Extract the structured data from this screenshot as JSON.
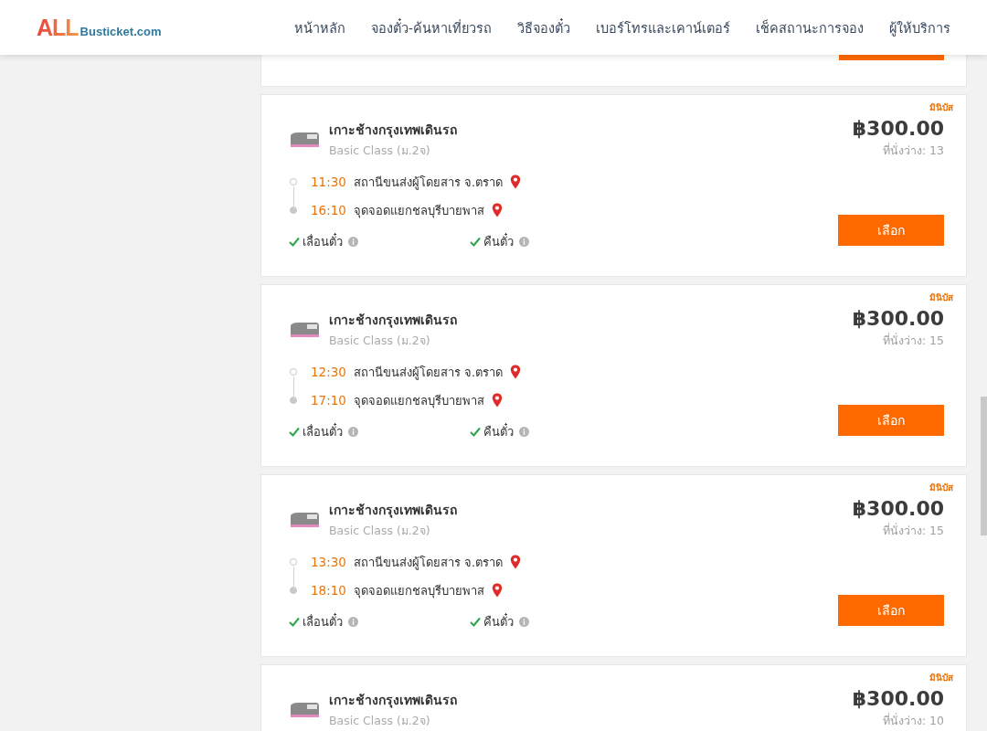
{
  "logo": {
    "mark": "ALL",
    "site": "Busticket.com"
  },
  "nav": [
    "หน้าหลัก",
    "จองตั๋ว-ค้นหาเที่ยวรถ",
    "วิธีจองตั๋ว",
    "เบอร์โทรและเคาน์เตอร์",
    "เช็คสถานะการจอง",
    "ผู้ให้บริการ"
  ],
  "trips": [
    {
      "type_label": "มินิบัส",
      "route": "เกาะช้างกรุงเทพเดินรถ",
      "bus_class": "Basic Class (ม.2จ)",
      "price": "฿300.00",
      "seats": "ที่นั่งว่าง: 13",
      "departure": {
        "time": "11:30",
        "place": "สถานีขนส่งผู้โดยสาร จ.ตราด"
      },
      "arrival": {
        "time": "16:10",
        "place": "จุดจอดแยกชลบุรีบายพาส"
      },
      "features": [
        {
          "label": "เลื่อนตั๋ว",
          "available": true
        },
        {
          "label": "คืนตั๋ว",
          "available": true
        }
      ],
      "button": "เลือก"
    },
    {
      "type_label": "มินิบัส",
      "route": "เกาะช้างกรุงเทพเดินรถ",
      "bus_class": "Basic Class (ม.2จ)",
      "price": "฿300.00",
      "seats": "ที่นั่งว่าง: 15",
      "departure": {
        "time": "12:30",
        "place": "สถานีขนส่งผู้โดยสาร จ.ตราด"
      },
      "arrival": {
        "time": "17:10",
        "place": "จุดจอดแยกชลบุรีบายพาส"
      },
      "features": [
        {
          "label": "เลื่อนตั๋ว",
          "available": true
        },
        {
          "label": "คืนตั๋ว",
          "available": true
        }
      ],
      "button": "เลือก"
    },
    {
      "type_label": "มินิบัส",
      "route": "เกาะช้างกรุงเทพเดินรถ",
      "bus_class": "Basic Class (ม.2จ)",
      "price": "฿300.00",
      "seats": "ที่นั่งว่าง: 15",
      "departure": {
        "time": "13:30",
        "place": "สถานีขนส่งผู้โดยสาร จ.ตราด"
      },
      "arrival": {
        "time": "18:10",
        "place": "จุดจอดแยกชลบุรีบายพาส"
      },
      "features": [
        {
          "label": "เลื่อนตั๋ว",
          "available": true
        },
        {
          "label": "คืนตั๋ว",
          "available": true
        }
      ],
      "button": "เลือก"
    },
    {
      "type_label": "มินิบัส",
      "route": "เกาะช้างกรุงเทพเดินรถ",
      "bus_class": "Basic Class (ม.2จ)",
      "price": "฿300.00",
      "seats": "ที่นั่งว่าง: 10"
    }
  ]
}
